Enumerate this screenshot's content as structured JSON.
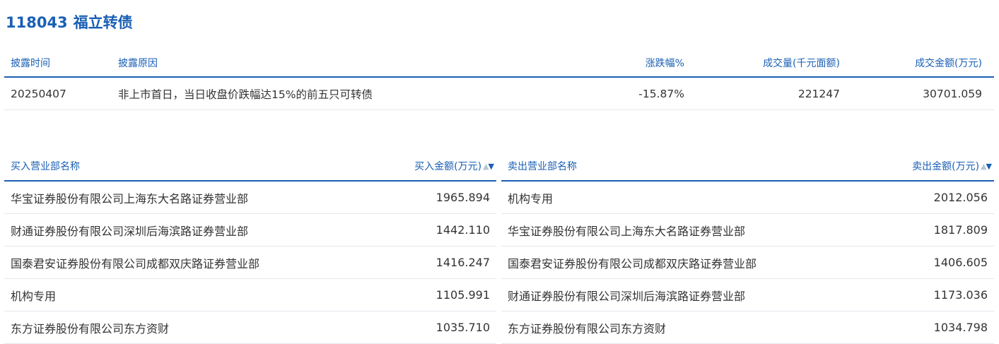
{
  "header": {
    "code": "118043",
    "name": "福立转债"
  },
  "disclosure": {
    "columns": {
      "date": "披露时间",
      "reason": "披露原因",
      "change": "涨跌幅%",
      "volume": "成交量(千元面额)",
      "amount": "成交金额(万元)"
    },
    "rows": [
      {
        "date": "20250407",
        "reason": "非上市首日，当日收盘价跌幅达15%的前五只可转债",
        "change": "-15.87%",
        "volume": "221247",
        "amount": "30701.059"
      }
    ]
  },
  "buy": {
    "name_header": "买入营业部名称",
    "amount_header": "买入金额(万元)",
    "sort_icons": [
      "sort-asc-icon",
      "sort-desc-icon"
    ],
    "rows": [
      {
        "name": "华宝证券股份有限公司上海东大名路证券营业部",
        "amount": "1965.894"
      },
      {
        "name": "财通证券股份有限公司深圳后海滨路证券营业部",
        "amount": "1442.110"
      },
      {
        "name": "国泰君安证券股份有限公司成都双庆路证券营业部",
        "amount": "1416.247"
      },
      {
        "name": "机构专用",
        "amount": "1105.991"
      },
      {
        "name": "东方证券股份有限公司东方资财",
        "amount": "1035.710"
      }
    ]
  },
  "sell": {
    "name_header": "卖出营业部名称",
    "amount_header": "卖出金额(万元)",
    "sort_icons": [
      "sort-asc-icon",
      "sort-desc-icon"
    ],
    "rows": [
      {
        "name": "机构专用",
        "amount": "2012.056"
      },
      {
        "name": "华宝证券股份有限公司上海东大名路证券营业部",
        "amount": "1817.809"
      },
      {
        "name": "国泰君安证券股份有限公司成都双庆路证券营业部",
        "amount": "1406.605"
      },
      {
        "name": "财通证券股份有限公司深圳后海滨路证券营业部",
        "amount": "1173.036"
      },
      {
        "name": "东方证券股份有限公司东方资财",
        "amount": "1034.798"
      }
    ]
  },
  "colors": {
    "accent": "#1a5fb4",
    "text": "#333333",
    "divider": "#e3e7ee",
    "sort_inactive": "#b8c4d4"
  }
}
